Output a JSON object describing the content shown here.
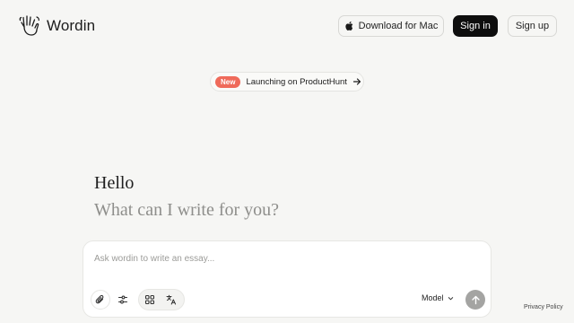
{
  "header": {
    "brand": "Wordin",
    "logo_icon": "hand-wave-icon",
    "download_label": "Download for Mac",
    "download_icon": "apple-icon",
    "signin_label": "Sign in",
    "signup_label": "Sign up"
  },
  "announcement": {
    "badge": "New",
    "text": "Launching on ProductHunt",
    "icon": "arrow-right-icon",
    "badge_color": "#ef6a5a"
  },
  "hero": {
    "greeting": "Hello",
    "question": "What can I write for you?"
  },
  "composer": {
    "placeholder": "Ask wordin to write an essay...",
    "value": "",
    "tools": [
      "paperclip-icon",
      "sliders-icon",
      "grid-icon",
      "translate-icon"
    ],
    "model_label": "Model",
    "model_icon": "chevron-down-icon",
    "send_icon": "arrow-up-icon"
  },
  "footer": {
    "privacy_label": "Privacy Policy"
  },
  "colors": {
    "background": "#f6f6f4",
    "signin_bg": "#0e0e0e",
    "send_bg": "#a4a4a2"
  }
}
